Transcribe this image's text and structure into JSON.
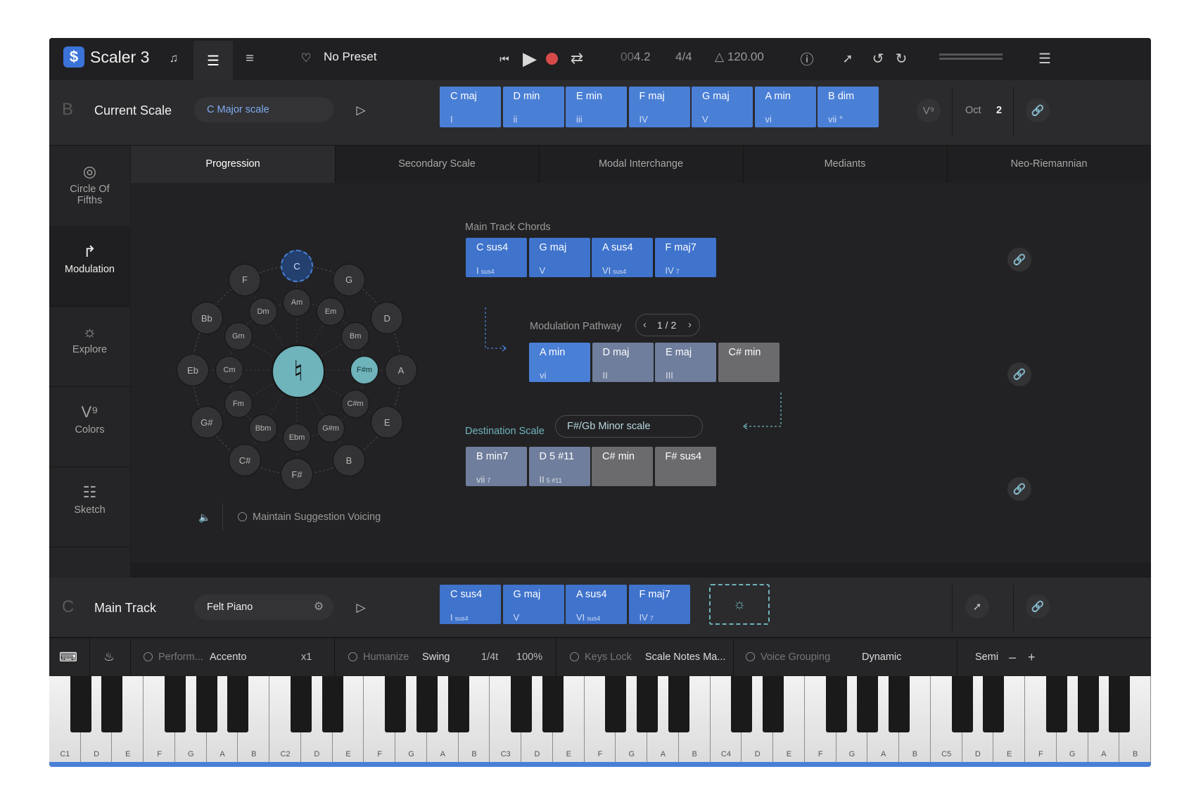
{
  "app": {
    "name": "Scaler 3",
    "preset": "No Preset"
  },
  "transport": {
    "position_dim": "00",
    "position": "4.2",
    "signature": "4/4",
    "tempo": "120.00"
  },
  "scale_row": {
    "section_letter": "B",
    "title": "Current Scale",
    "scale_name": "C Major scale",
    "chords": [
      {
        "name": "C maj",
        "degree": "I"
      },
      {
        "name": "D min",
        "degree": "ii"
      },
      {
        "name": "E min",
        "degree": "iii"
      },
      {
        "name": "F maj",
        "degree": "IV"
      },
      {
        "name": "G maj",
        "degree": "V"
      },
      {
        "name": "A min",
        "degree": "vi"
      },
      {
        "name": "B dim",
        "degree": "vii °"
      }
    ],
    "colors_label": "V⁹",
    "oct_label": "Oct",
    "oct_value": "2"
  },
  "sidebar": [
    {
      "label": "Circle Of Fifths",
      "icon": "circle-icon"
    },
    {
      "label": "Modulation",
      "icon": "modulation-icon"
    },
    {
      "label": "Explore",
      "icon": "lightbulb-icon"
    },
    {
      "label": "Colors",
      "icon": "colors-icon"
    },
    {
      "label": "Sketch",
      "icon": "grid-icon"
    }
  ],
  "tabs": [
    "Progression",
    "Secondary Scale",
    "Modal Interchange",
    "Mediants",
    "Neo-Riemannian"
  ],
  "circle": {
    "center_symbol": "♮",
    "major": [
      "C",
      "G",
      "D",
      "A",
      "E",
      "B",
      "F#",
      "C#",
      "G#",
      "Eb",
      "Bb",
      "F"
    ],
    "minor": [
      "Am",
      "Em",
      "Bm",
      "F#m",
      "C#m",
      "G#m",
      "Ebm",
      "Bbm",
      "Fm",
      "Cm",
      "Gm",
      "Dm"
    ],
    "selected_major": "C",
    "selected_minor": "F#m"
  },
  "maintain_voicing": "Maintain Suggestion Voicing",
  "main_track_chords": {
    "label": "Main Track Chords",
    "chords": [
      {
        "name": "C sus4",
        "degree": "I",
        "ext": "sus4"
      },
      {
        "name": "G maj",
        "degree": "V",
        "ext": ""
      },
      {
        "name": "A sus4",
        "degree": "VI",
        "ext": "sus4"
      },
      {
        "name": "F maj7",
        "degree": "IV",
        "ext": "7"
      }
    ]
  },
  "pathway": {
    "label": "Modulation Pathway",
    "pager": "1 / 2",
    "chords": [
      {
        "name": "A min",
        "degree": "vi"
      },
      {
        "name": "D maj",
        "degree": "II"
      },
      {
        "name": "E maj",
        "degree": "III"
      },
      {
        "name": "C# min",
        "degree": ""
      }
    ]
  },
  "destination": {
    "label": "Destination Scale",
    "scale": "F#/Gb Minor scale",
    "chords": [
      {
        "name": "B min7",
        "degree": "vii",
        "ext": "7"
      },
      {
        "name": "D 5 #11",
        "degree": "II",
        "ext": "5 #11"
      },
      {
        "name": "C# min",
        "degree": "",
        "ext": ""
      },
      {
        "name": "F# sus4",
        "degree": "",
        "ext": ""
      }
    ]
  },
  "main_track": {
    "section_letter": "C",
    "title": "Main Track",
    "instrument": "Felt Piano",
    "chords": [
      {
        "name": "C sus4",
        "degree": "I",
        "ext": "sus4"
      },
      {
        "name": "G maj",
        "degree": "V",
        "ext": ""
      },
      {
        "name": "A sus4",
        "degree": "VI",
        "ext": "sus4"
      },
      {
        "name": "F maj7",
        "degree": "IV",
        "ext": "7"
      }
    ]
  },
  "options": {
    "perform_label": "Perform...",
    "perform_value": "Accento",
    "perform_mult": "x1",
    "humanize_label": "Humanize",
    "swing_label": "Swing",
    "swing_div": "1/4t",
    "swing_pct": "100%",
    "keyslock_label": "Keys Lock",
    "keyslock_value": "Scale Notes Ma...",
    "voicegroup_label": "Voice Grouping",
    "voicegroup_value": "Dynamic",
    "semi_label": "Semi"
  },
  "keyboard": {
    "white_labels": [
      "C1",
      "D",
      "E",
      "F",
      "G",
      "A",
      "B",
      "C2",
      "D",
      "E",
      "F",
      "G",
      "A",
      "B",
      "C3",
      "D",
      "E",
      "F",
      "G",
      "A",
      "B",
      "C4",
      "D",
      "E",
      "F",
      "G",
      "A",
      "B",
      "C5",
      "D",
      "E",
      "F",
      "G",
      "A",
      "B"
    ]
  },
  "colors": {
    "accent_blue": "#4a7fd6",
    "teal": "#6fb3bb",
    "record": "#d84a4a"
  }
}
